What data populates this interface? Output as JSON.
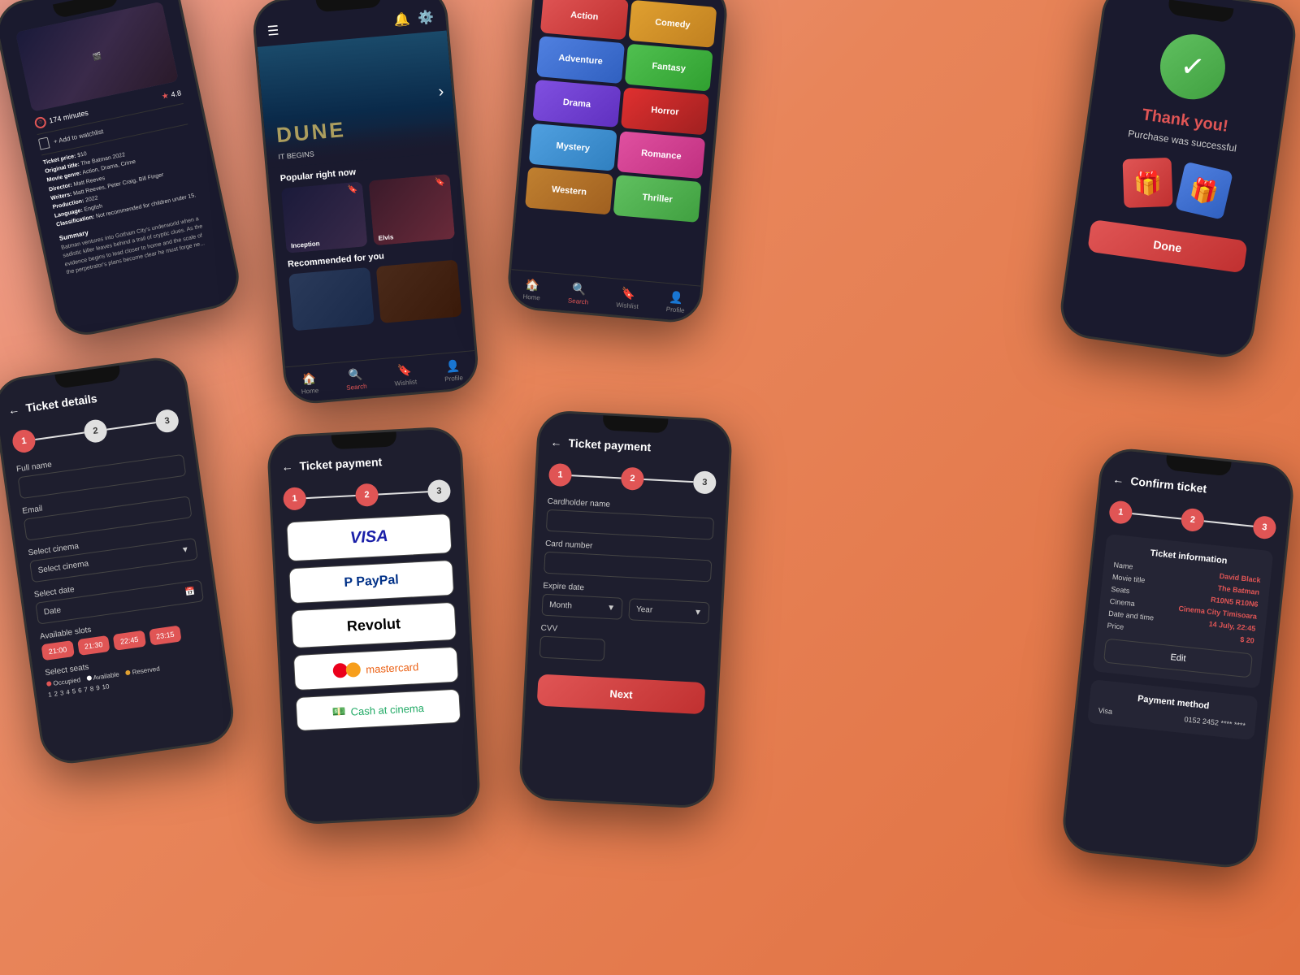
{
  "background": "#e07045",
  "phones": {
    "phone1": {
      "runtime": "174 minutes",
      "rating": "4.8",
      "add_watchlist": "+ Add to watchlist",
      "ticket_price_label": "Ticket price:",
      "ticket_price": "$10",
      "original_title_label": "Original title:",
      "original_title": "The Batman 2022",
      "movie_genre_label": "Movie genre:",
      "movie_genre": "Action, Drama, Crime",
      "director_label": "Director:",
      "director": "Matt Reeves",
      "writers_label": "Writers:",
      "writers": "Matt Reeves, Peter Craig, Bill Finger",
      "production_label": "Production:",
      "production": "2022",
      "language_label": "Language:",
      "language": "English",
      "classification_label": "Classification:",
      "classification": "Not recommended for children under 15.",
      "summary_title": "Summary",
      "summary_text": "Batman ventures into Gotham City's underworld when a sadistic killer leaves behind a trail of cryptic clues. As the evidence begins to lead closer to home and the scale of the perpetrator's plans become clear he must forge ne..."
    },
    "phone2": {
      "popular_title": "Popular right now",
      "recommended_title": "Recommended for you",
      "movie1_label": "Inception",
      "movie2_label": "Elvis",
      "nav_items": [
        "Home",
        "Search",
        "Wishlist",
        "Profile"
      ],
      "active_nav": "Search"
    },
    "phone3": {
      "genres": [
        "Action",
        "Comedy",
        "Adventure",
        "Fantasy",
        "Drama",
        "Horror",
        "Mystery",
        "Romance",
        "Western",
        "Thriller"
      ]
    },
    "phone4": {
      "thank_you": "Thank you!",
      "subtitle": "Purchase was successful",
      "done_label": "Done"
    },
    "phone5": {
      "title": "Ticket details",
      "steps": [
        "1",
        "2",
        "3"
      ],
      "full_name_label": "Full name",
      "email_label": "Email",
      "select_cinema_label": "Select cinema",
      "select_cinema_placeholder": "Select cinema",
      "select_date_label": "Select date",
      "date_placeholder": "Date",
      "available_slots_label": "Available slots",
      "slots": [
        "21:00",
        "21:30",
        "22:45",
        "23:15"
      ],
      "select_seats_label": "Select seats",
      "legend": [
        "Occupied",
        "Available",
        "Reserved"
      ],
      "seat_numbers": [
        "1",
        "2",
        "3",
        "4",
        "5",
        "6",
        "7",
        "8",
        "9",
        "10"
      ]
    },
    "phone6": {
      "title": "Ticket payment",
      "steps": [
        "1",
        "2",
        "3"
      ],
      "payment_methods": [
        "VISA",
        "PayPal",
        "Revolut",
        "mastercard",
        "Cash at cinema"
      ]
    },
    "phone7": {
      "title": "Ticket payment",
      "steps": [
        "1",
        "2",
        "3"
      ],
      "cardholder_label": "Cardholder name",
      "card_number_label": "Card number",
      "expire_label": "Expire date",
      "month_placeholder": "Month",
      "year_placeholder": "Year",
      "cvv_label": "CVV",
      "next_label": "Next"
    },
    "phone8": {
      "title": "Confirm ticket",
      "steps": [
        "1",
        "2",
        "3"
      ],
      "ticket_info_title": "Ticket information",
      "fields": {
        "name_label": "Name",
        "name_val": "David Black",
        "movie_label": "Movie title",
        "movie_val": "The Batman",
        "seats_label": "Seats",
        "seats_val": "R10N5  R10N6",
        "cinema_label": "Cinema",
        "cinema_val": "Cinema City Timisoara",
        "datetime_label": "Date and time",
        "datetime_val": "14 July, 22:45",
        "price_label": "Price",
        "price_val": "$ 20"
      },
      "edit_label": "Edit",
      "payment_title": "Payment method",
      "payment_key": "Visa",
      "payment_val": "0152 2452 **** ****"
    }
  }
}
